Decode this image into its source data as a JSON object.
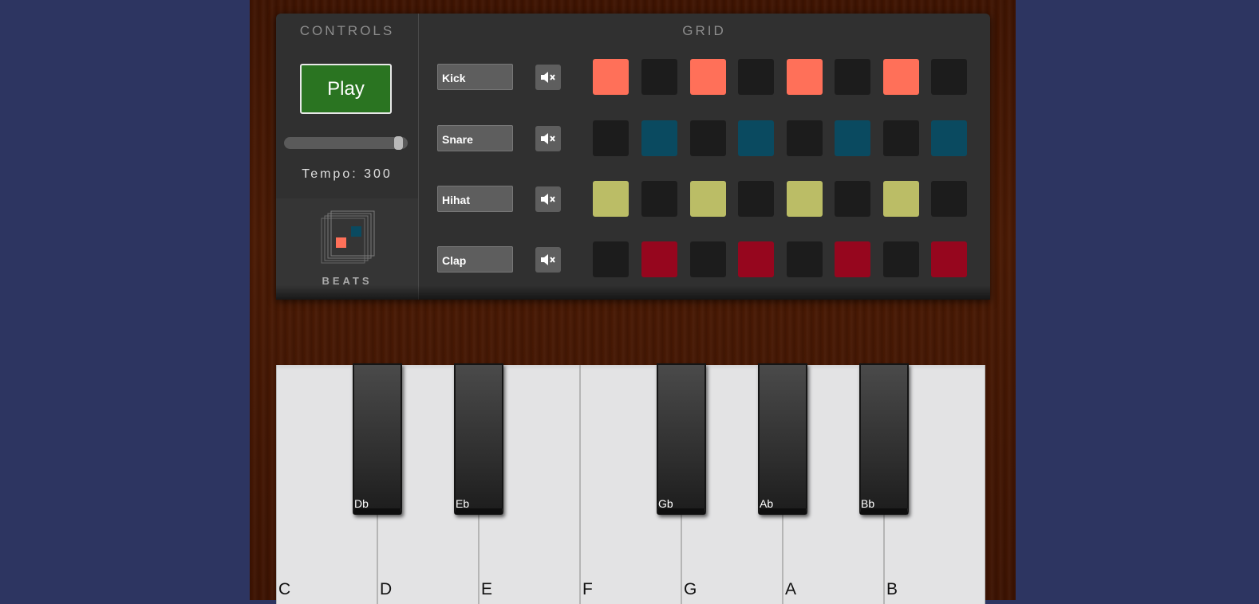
{
  "controls": {
    "title": "CONTROLS",
    "play_label": "Play",
    "tempo_text": "Tempo: 300",
    "tempo_value": 300,
    "slider_fraction": 0.96,
    "logo_text": "BEATS",
    "colors": {
      "play_bg": "#2a7421"
    }
  },
  "grid": {
    "title": "GRID",
    "mute_icon": "speaker-mute-icon",
    "off_color": "#1c1c1c",
    "tracks": [
      {
        "name": "Kick",
        "color": "#ff7059",
        "steps": [
          1,
          0,
          1,
          0,
          1,
          0,
          1,
          0
        ]
      },
      {
        "name": "Snare",
        "color": "#0a4a60",
        "steps": [
          0,
          1,
          0,
          1,
          0,
          1,
          0,
          1
        ]
      },
      {
        "name": "Hihat",
        "color": "#bbbd66",
        "steps": [
          1,
          0,
          1,
          0,
          1,
          0,
          1,
          0
        ]
      },
      {
        "name": "Clap",
        "color": "#96061e",
        "steps": [
          0,
          1,
          0,
          1,
          0,
          1,
          0,
          1
        ]
      }
    ]
  },
  "keyboard": {
    "white_keys": [
      "C",
      "D",
      "E",
      "F",
      "G",
      "A",
      "B"
    ],
    "black_keys": [
      "Db",
      "Eb",
      "Gb",
      "Ab",
      "Bb"
    ]
  }
}
